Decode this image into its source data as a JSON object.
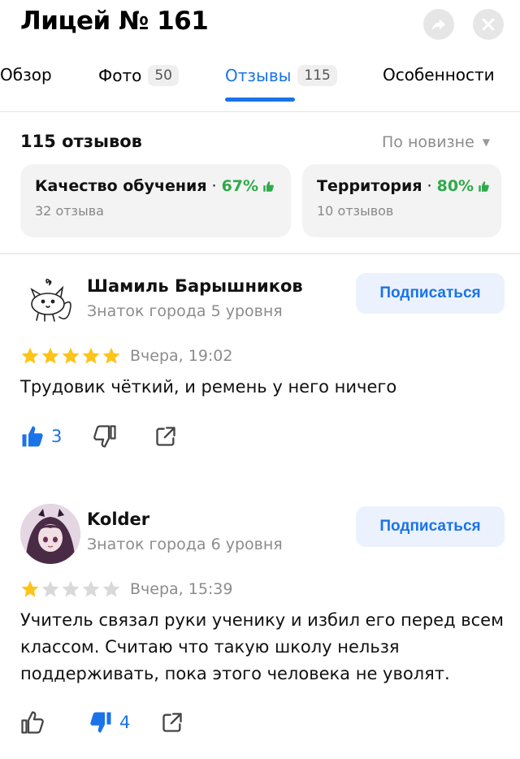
{
  "header": {
    "title": "Лицей № 161"
  },
  "tabs": [
    {
      "label": "Обзор",
      "count": ""
    },
    {
      "label": "Фото",
      "count": "50"
    },
    {
      "label": "Отзывы",
      "count": "115"
    },
    {
      "label": "Особенности",
      "count": ""
    }
  ],
  "reviews_summary": {
    "count_label": "115 отзывов",
    "sort_label": "По новизне"
  },
  "aspects": [
    {
      "name": "Качество обучения",
      "percent": "67%",
      "reviews": "32 отзыва"
    },
    {
      "name": "Территория",
      "percent": "80%",
      "reviews": "10 отзывов"
    }
  ],
  "reviews": [
    {
      "author": "Шамиль Барышников",
      "level": "Знаток города 5 уровня",
      "subscribe_label": "Подписаться",
      "rating": 5,
      "date": "Вчера, 19:02",
      "text": "Трудовик чёткий, и ремень у него ничего",
      "likes": "3",
      "dislikes": ""
    },
    {
      "author": "Kolder",
      "level": "Знаток города 6 уровня",
      "subscribe_label": "Подписаться",
      "rating": 1,
      "date": "Вчера, 15:39",
      "text": "Учитель связал руки ученику и избил его перед всем классом. Считаю что такую школу нельзя поддерживать, пока этого человека не уволят.",
      "likes": "",
      "dislikes": "4"
    }
  ],
  "colors": {
    "accent": "#1a73e8",
    "positive": "#2eaa4a",
    "star": "#fcc419",
    "star_empty": "#d9d9d9"
  },
  "icons": [
    "share-icon",
    "close-icon",
    "thumb-up-icon",
    "thumb-down-icon",
    "external-share-icon",
    "sort-caret-icon"
  ]
}
